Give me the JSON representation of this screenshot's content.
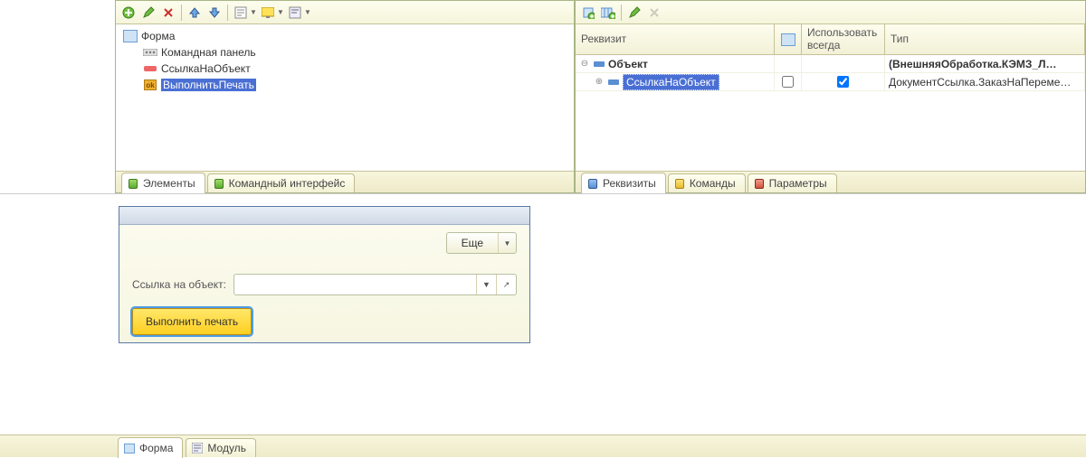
{
  "left_panel": {
    "tree": {
      "root": "Форма",
      "items": [
        {
          "icon": "cmdpanel",
          "label": "Командная панель"
        },
        {
          "icon": "field",
          "label": "СсылкаНаОбъект"
        },
        {
          "icon": "button",
          "label": "ВыполнитьПечать",
          "selected": true
        }
      ]
    },
    "tabs": [
      "Элементы",
      "Командный интерфейс"
    ]
  },
  "right_panel": {
    "columns": {
      "c0": "Реквизит",
      "c1": "",
      "c2": "Использовать всегда",
      "c3": "Тип"
    },
    "rows": [
      {
        "level": 0,
        "exp": "minus",
        "label": "Объект",
        "bold": true,
        "use": false,
        "use_checked": false,
        "alwaysHidden": true,
        "type": "(ВнешняяОбработка.КЭМЗ_Л…",
        "typeBold": true
      },
      {
        "level": 1,
        "exp": "plus",
        "label": "СсылкаНаОбъект",
        "selected": true,
        "use": true,
        "use_checked": false,
        "always": true,
        "type": "ДокументСсылка.ЗаказНаПереме…"
      }
    ],
    "tabs": [
      "Реквизиты",
      "Команды",
      "Параметры"
    ]
  },
  "preview": {
    "more": "Еще",
    "field_label": "Ссылка на объект:",
    "field_value": "",
    "exec": "Выполнить печать"
  },
  "bottom_tabs": [
    "Форма",
    "Модуль"
  ]
}
